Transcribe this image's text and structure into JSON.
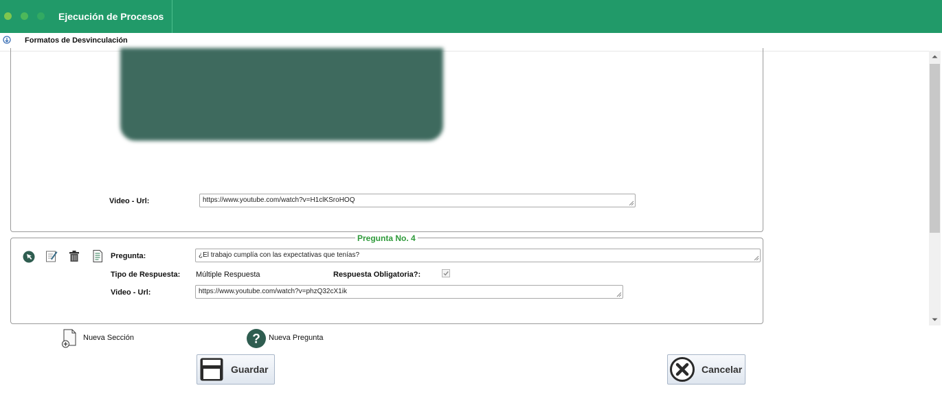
{
  "app": {
    "title": "Ejecución de Procesos"
  },
  "breadcrumb": {
    "label": "Formatos de Desvinculación"
  },
  "section1": {
    "video_label": "Video - Url:",
    "video_url": "https://www.youtube.com/watch?v=H1clKSroHOQ"
  },
  "question": {
    "heading": "Pregunta No. 4",
    "pregunta_label": "Pregunta:",
    "pregunta_value": "¿El trabajo cumplía con las expectativas que tenías?",
    "tipo_label": "Tipo de Respuesta:",
    "tipo_value": "Múltiple Respuesta",
    "obligatoria_label": "Respuesta Obligatoria?:",
    "obligatoria_checked": true,
    "video_label": "Video - Url:",
    "video_url": "https://www.youtube.com/watch?v=phzQ32cX1ik"
  },
  "actions": {
    "nueva_seccion": "Nueva Sección",
    "nueva_pregunta": "Nueva Pregunta",
    "guardar": "Guardar",
    "cancelar": "Cancelar"
  },
  "icons": {
    "question_tools": [
      "cursor-icon",
      "edit-icon",
      "trash-icon",
      "document-icon"
    ],
    "breadcrumb": "info-down-icon"
  },
  "colors": {
    "header": "#219a69",
    "heading_green": "#2e9a3a",
    "dark_green": "#2f5d50"
  }
}
